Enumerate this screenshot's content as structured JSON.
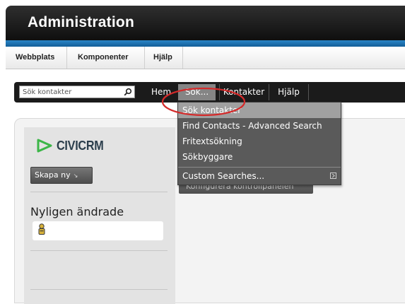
{
  "header": {
    "title": "Administration"
  },
  "joomla_menu": {
    "items": [
      "Webbplats",
      "Komponenter",
      "Hjälp"
    ]
  },
  "civi_nav": {
    "search_placeholder": "Sök kontakter",
    "items": [
      "Hem",
      "Sök...",
      "Kontakter",
      "Hjälp"
    ]
  },
  "dropdown": {
    "items": [
      "Sök kontakter",
      "Find Contacts - Advanced Search",
      "Fritextsökning",
      "Sökbyggare",
      "Custom Searches..."
    ]
  },
  "sidebar": {
    "logo_civi": "CIVI",
    "logo_crm": "CRM",
    "create_button": "Skapa ny",
    "recent_title": "Nyligen ändrade"
  },
  "configure_button": "Konfigurera kontrollpanelen",
  "colors": {
    "nav_bg": "#1b1b1b",
    "accent_blue": "#1b6fb0",
    "logo_green": "#3cb648",
    "annotation_red": "#d42a2a"
  }
}
